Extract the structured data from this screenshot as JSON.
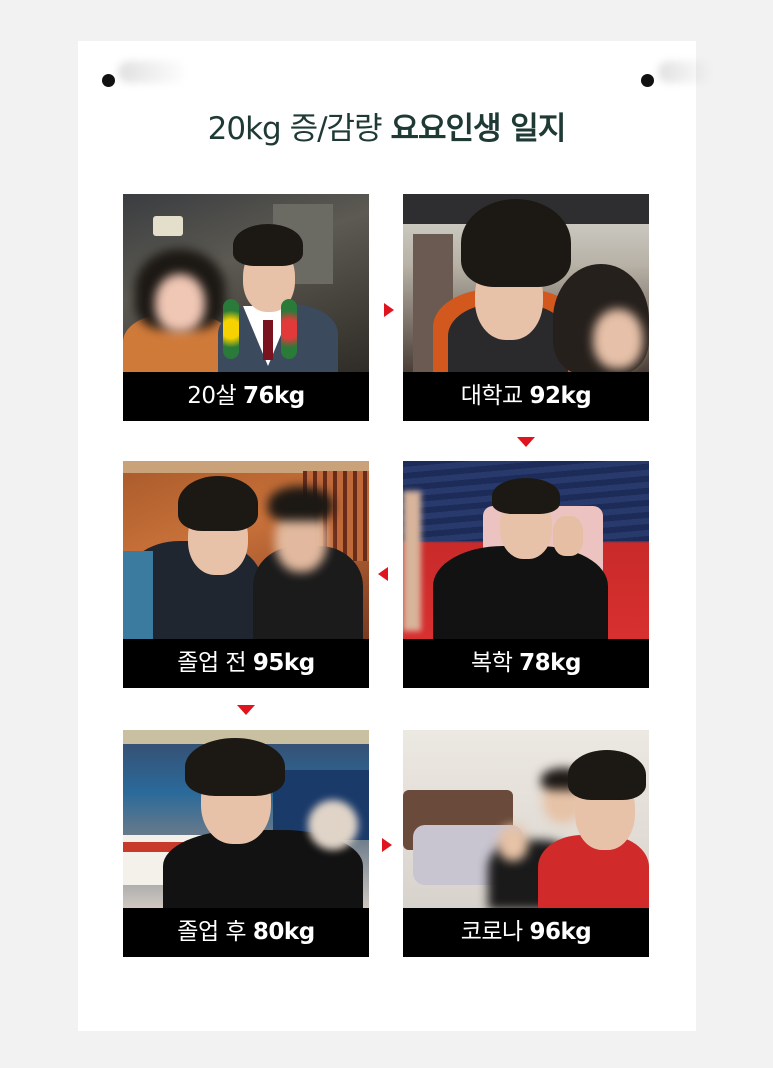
{
  "title": {
    "light": "20kg 증/감량 ",
    "bold": "요요인생 일지"
  },
  "tiles": [
    {
      "label": "20살",
      "weight": "76kg"
    },
    {
      "label": "대학교",
      "weight": "92kg"
    },
    {
      "label": "졸업 전",
      "weight": "95kg"
    },
    {
      "label": "복학",
      "weight": "78kg"
    },
    {
      "label": "졸업 후",
      "weight": "80kg"
    },
    {
      "label": "코로나",
      "weight": "96kg"
    }
  ],
  "colors": {
    "accent": "#e0141e",
    "title": "#1f3a35",
    "caption_bg": "#000000"
  }
}
